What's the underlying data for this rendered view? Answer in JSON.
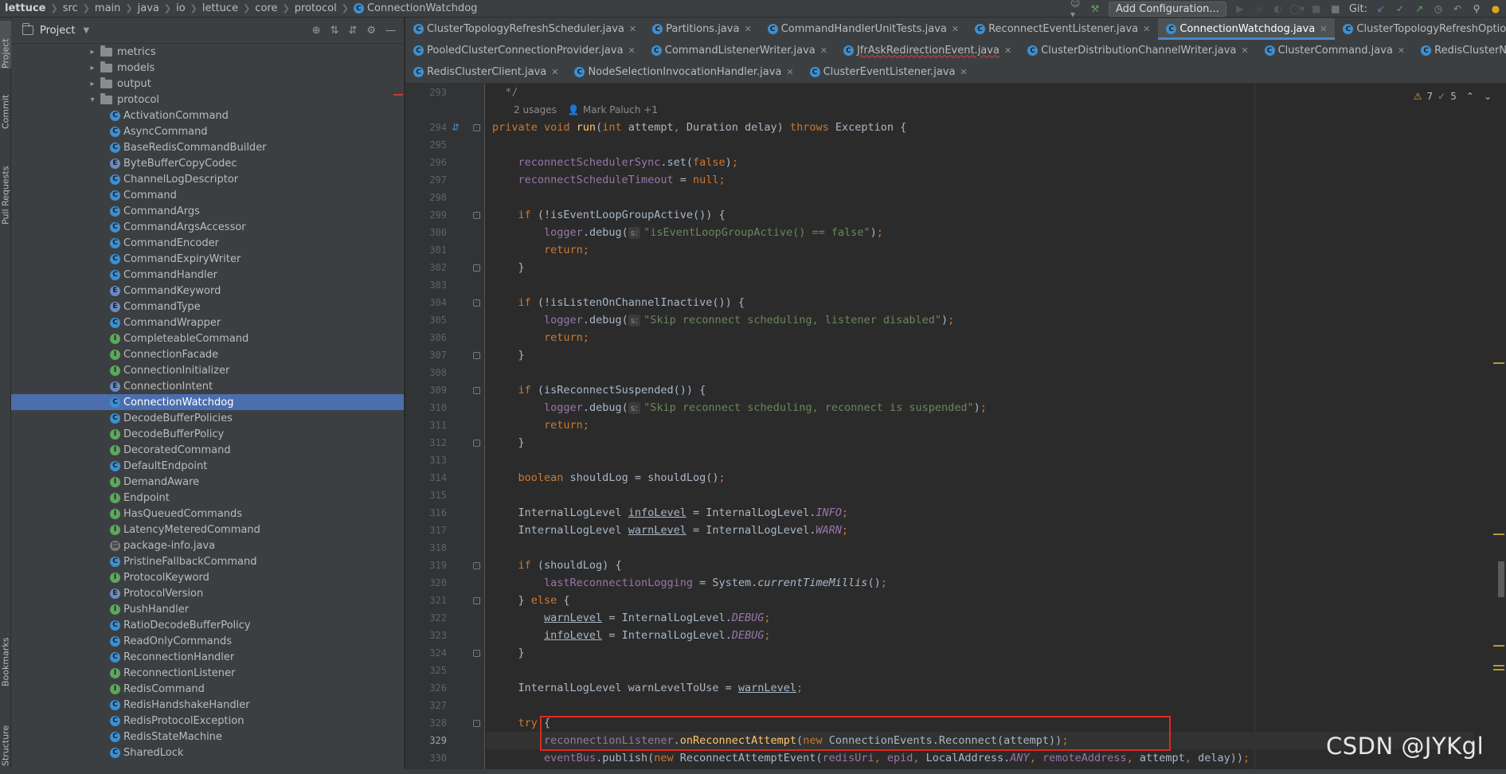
{
  "breadcrumb": [
    "lettuce",
    "src",
    "main",
    "java",
    "io",
    "lettuce",
    "core",
    "protocol",
    "ConnectionWatchdog"
  ],
  "toolbar": {
    "add_config": "Add Configuration...",
    "git_label": "Git:"
  },
  "left_strip": {
    "project": "Project",
    "commit": "Commit",
    "pull_requests": "Pull Requests",
    "bookmarks": "Bookmarks",
    "structure": "Structure"
  },
  "project_panel": {
    "title": "Project",
    "folders": [
      {
        "name": "metrics",
        "expanded": false
      },
      {
        "name": "models",
        "expanded": false
      },
      {
        "name": "output",
        "expanded": false
      },
      {
        "name": "protocol",
        "expanded": true
      }
    ],
    "files": [
      {
        "name": "ActivationCommand",
        "kind": "C"
      },
      {
        "name": "AsyncCommand",
        "kind": "C"
      },
      {
        "name": "BaseRedisCommandBuilder",
        "kind": "C"
      },
      {
        "name": "ByteBufferCopyCodec",
        "kind": "E"
      },
      {
        "name": "ChannelLogDescriptor",
        "kind": "C"
      },
      {
        "name": "Command",
        "kind": "C"
      },
      {
        "name": "CommandArgs",
        "kind": "C"
      },
      {
        "name": "CommandArgsAccessor",
        "kind": "C"
      },
      {
        "name": "CommandEncoder",
        "kind": "C"
      },
      {
        "name": "CommandExpiryWriter",
        "kind": "C"
      },
      {
        "name": "CommandHandler",
        "kind": "C"
      },
      {
        "name": "CommandKeyword",
        "kind": "E"
      },
      {
        "name": "CommandType",
        "kind": "E"
      },
      {
        "name": "CommandWrapper",
        "kind": "C"
      },
      {
        "name": "CompleteableCommand",
        "kind": "I"
      },
      {
        "name": "ConnectionFacade",
        "kind": "I"
      },
      {
        "name": "ConnectionInitializer",
        "kind": "I"
      },
      {
        "name": "ConnectionIntent",
        "kind": "E"
      },
      {
        "name": "ConnectionWatchdog",
        "kind": "C",
        "selected": true
      },
      {
        "name": "DecodeBufferPolicies",
        "kind": "C"
      },
      {
        "name": "DecodeBufferPolicy",
        "kind": "I"
      },
      {
        "name": "DecoratedCommand",
        "kind": "I"
      },
      {
        "name": "DefaultEndpoint",
        "kind": "C"
      },
      {
        "name": "DemandAware",
        "kind": "I"
      },
      {
        "name": "Endpoint",
        "kind": "I"
      },
      {
        "name": "HasQueuedCommands",
        "kind": "I"
      },
      {
        "name": "LatencyMeteredCommand",
        "kind": "I"
      },
      {
        "name": "package-info.java",
        "kind": "P"
      },
      {
        "name": "PristineFallbackCommand",
        "kind": "C"
      },
      {
        "name": "ProtocolKeyword",
        "kind": "I"
      },
      {
        "name": "ProtocolVersion",
        "kind": "E"
      },
      {
        "name": "PushHandler",
        "kind": "I"
      },
      {
        "name": "RatioDecodeBufferPolicy",
        "kind": "C"
      },
      {
        "name": "ReadOnlyCommands",
        "kind": "C"
      },
      {
        "name": "ReconnectionHandler",
        "kind": "C"
      },
      {
        "name": "ReconnectionListener",
        "kind": "I"
      },
      {
        "name": "RedisCommand",
        "kind": "I"
      },
      {
        "name": "RedisHandshakeHandler",
        "kind": "C"
      },
      {
        "name": "RedisProtocolException",
        "kind": "C"
      },
      {
        "name": "RedisStateMachine",
        "kind": "C"
      },
      {
        "name": "SharedLock",
        "kind": "C"
      }
    ]
  },
  "tabs": {
    "row1": [
      {
        "label": "ClusterTopologyRefreshScheduler.java"
      },
      {
        "label": "Partitions.java"
      },
      {
        "label": "CommandHandlerUnitTests.java"
      },
      {
        "label": "ReconnectEventListener.java"
      },
      {
        "label": "ConnectionWatchdog.java",
        "active": true
      },
      {
        "label": "ClusterTopologyRefreshOptions.java"
      }
    ],
    "row2": [
      {
        "label": "PooledClusterConnectionProvider.java"
      },
      {
        "label": "CommandListenerWriter.java"
      },
      {
        "label": "JfrAskRedirectionEvent.java",
        "error": true
      },
      {
        "label": "ClusterDistributionChannelWriter.java"
      },
      {
        "label": "ClusterCommand.java"
      },
      {
        "label": "RedisClusterNode.java"
      }
    ],
    "row3": [
      {
        "label": "RedisClusterClient.java"
      },
      {
        "label": "NodeSelectionInvocationHandler.java"
      },
      {
        "label": "ClusterEventListener.java"
      }
    ]
  },
  "inspections": {
    "warnings": "7",
    "checks": "5"
  },
  "code_lens": {
    "usages": "2 usages",
    "author": "Mark Paluch +1"
  },
  "code": [
    {
      "n": "293",
      "html": "<span class=\"cmt\">  */</span>"
    },
    {
      "n": "294",
      "html": "<span class=\"kw\">private void </span><span class=\"fn\">run</span>(<span class=\"kw\">int </span>attempt<span class=\"kw\">, </span>Duration delay) <span class=\"kw\">throws </span>Exception {"
    },
    {
      "n": "295",
      "html": ""
    },
    {
      "n": "296",
      "html": "    <span class=\"fld\">reconnectSchedulerSync</span>.set(<span class=\"kw\">false</span>)<span class=\"kw\">;</span>"
    },
    {
      "n": "297",
      "html": "    <span class=\"fld\">reconnectScheduleTimeout </span>= <span class=\"kw\">null;</span>"
    },
    {
      "n": "298",
      "html": ""
    },
    {
      "n": "299",
      "html": "    <span class=\"kw\">if </span>(!isEventLoopGroupActive()) {"
    },
    {
      "n": "300",
      "html": "        <span class=\"fld\">logger</span>.debug(<span class=\"hint\">s:</span><span class=\"str\">\"isEventLoopGroupActive() == false\"</span>)<span class=\"kw\">;</span>"
    },
    {
      "n": "301",
      "html": "        <span class=\"kw\">return;</span>"
    },
    {
      "n": "302",
      "html": "    }"
    },
    {
      "n": "303",
      "html": ""
    },
    {
      "n": "304",
      "html": "    <span class=\"kw\">if </span>(!isListenOnChannelInactive()) {"
    },
    {
      "n": "305",
      "html": "        <span class=\"fld\">logger</span>.debug(<span class=\"hint\">s:</span><span class=\"str\">\"Skip reconnect scheduling, listener disabled\"</span>)<span class=\"kw\">;</span>"
    },
    {
      "n": "306",
      "html": "        <span class=\"kw\">return;</span>"
    },
    {
      "n": "307",
      "html": "    }"
    },
    {
      "n": "308",
      "html": ""
    },
    {
      "n": "309",
      "html": "    <span class=\"kw\">if </span>(isReconnectSuspended()) {"
    },
    {
      "n": "310",
      "html": "        <span class=\"fld\">logger</span>.debug(<span class=\"hint\">s:</span><span class=\"str\">\"Skip reconnect scheduling, reconnect is suspended\"</span>)<span class=\"kw\">;</span>"
    },
    {
      "n": "311",
      "html": "        <span class=\"kw\">return;</span>"
    },
    {
      "n": "312",
      "html": "    }"
    },
    {
      "n": "313",
      "html": ""
    },
    {
      "n": "314",
      "html": "    <span class=\"kw\">boolean </span>shouldLog = shouldLog()<span class=\"kw\">;</span>"
    },
    {
      "n": "315",
      "html": ""
    },
    {
      "n": "316",
      "html": "    InternalLogLevel <span class=\"ul\">infoLevel</span> = InternalLogLevel.<span class=\"fld it\">INFO</span><span class=\"kw\">;</span>"
    },
    {
      "n": "317",
      "html": "    InternalLogLevel <span class=\"ul\">warnLevel</span> = InternalLogLevel.<span class=\"fld it\">WARN</span><span class=\"kw\">;</span>"
    },
    {
      "n": "318",
      "html": ""
    },
    {
      "n": "319",
      "html": "    <span class=\"kw\">if </span>(shouldLog) {"
    },
    {
      "n": "320",
      "html": "        <span class=\"fld\">lastReconnectionLogging </span>= System.<span class=\"it\">currentTimeMillis</span>()<span class=\"kw\">;</span>"
    },
    {
      "n": "321",
      "html": "    } <span class=\"kw\">else </span>{"
    },
    {
      "n": "322",
      "html": "        <span class=\"ul\">warnLevel</span> = InternalLogLevel.<span class=\"fld it\">DEBUG</span><span class=\"kw\">;</span>"
    },
    {
      "n": "323",
      "html": "        <span class=\"ul\">infoLevel</span> = InternalLogLevel.<span class=\"fld it\">DEBUG</span><span class=\"kw\">;</span>"
    },
    {
      "n": "324",
      "html": "    }"
    },
    {
      "n": "325",
      "html": ""
    },
    {
      "n": "326",
      "html": "    InternalLogLevel warnLevelToUse = <span class=\"ul\">warnLevel</span><span class=\"kw\">;</span>"
    },
    {
      "n": "327",
      "html": ""
    },
    {
      "n": "328",
      "html": "    <span class=\"kw\">try </span>{"
    },
    {
      "n": "329",
      "html": "        <span class=\"fld\">reconnectionListener</span>.<span class=\"fn\">onReconnectAttempt</span>(<span class=\"kw\">new </span>ConnectionEvents.Reconnect(attempt))<span class=\"kw\">;</span>"
    },
    {
      "n": "330",
      "html": "        <span class=\"fld\">eventBus</span>.publish(<span class=\"kw\">new </span>ReconnectAttemptEvent(<span class=\"fld\">redisUri</span><span class=\"kw\">, </span><span class=\"fld\">epid</span><span class=\"kw\">, </span>LocalAddress.<span class=\"fld it\">ANY</span><span class=\"kw\">, </span><span class=\"fld\">remoteAddress</span><span class=\"kw\">, </span>attempt<span class=\"kw\">, </span>delay))<span class=\"kw\">;</span>"
    }
  ],
  "current_line": "329",
  "watermark": "CSDN @JYKgl",
  "colors": {
    "accent": "#4a88c7",
    "selection": "#4b6eaf",
    "highlight_box": "#e0281f"
  }
}
